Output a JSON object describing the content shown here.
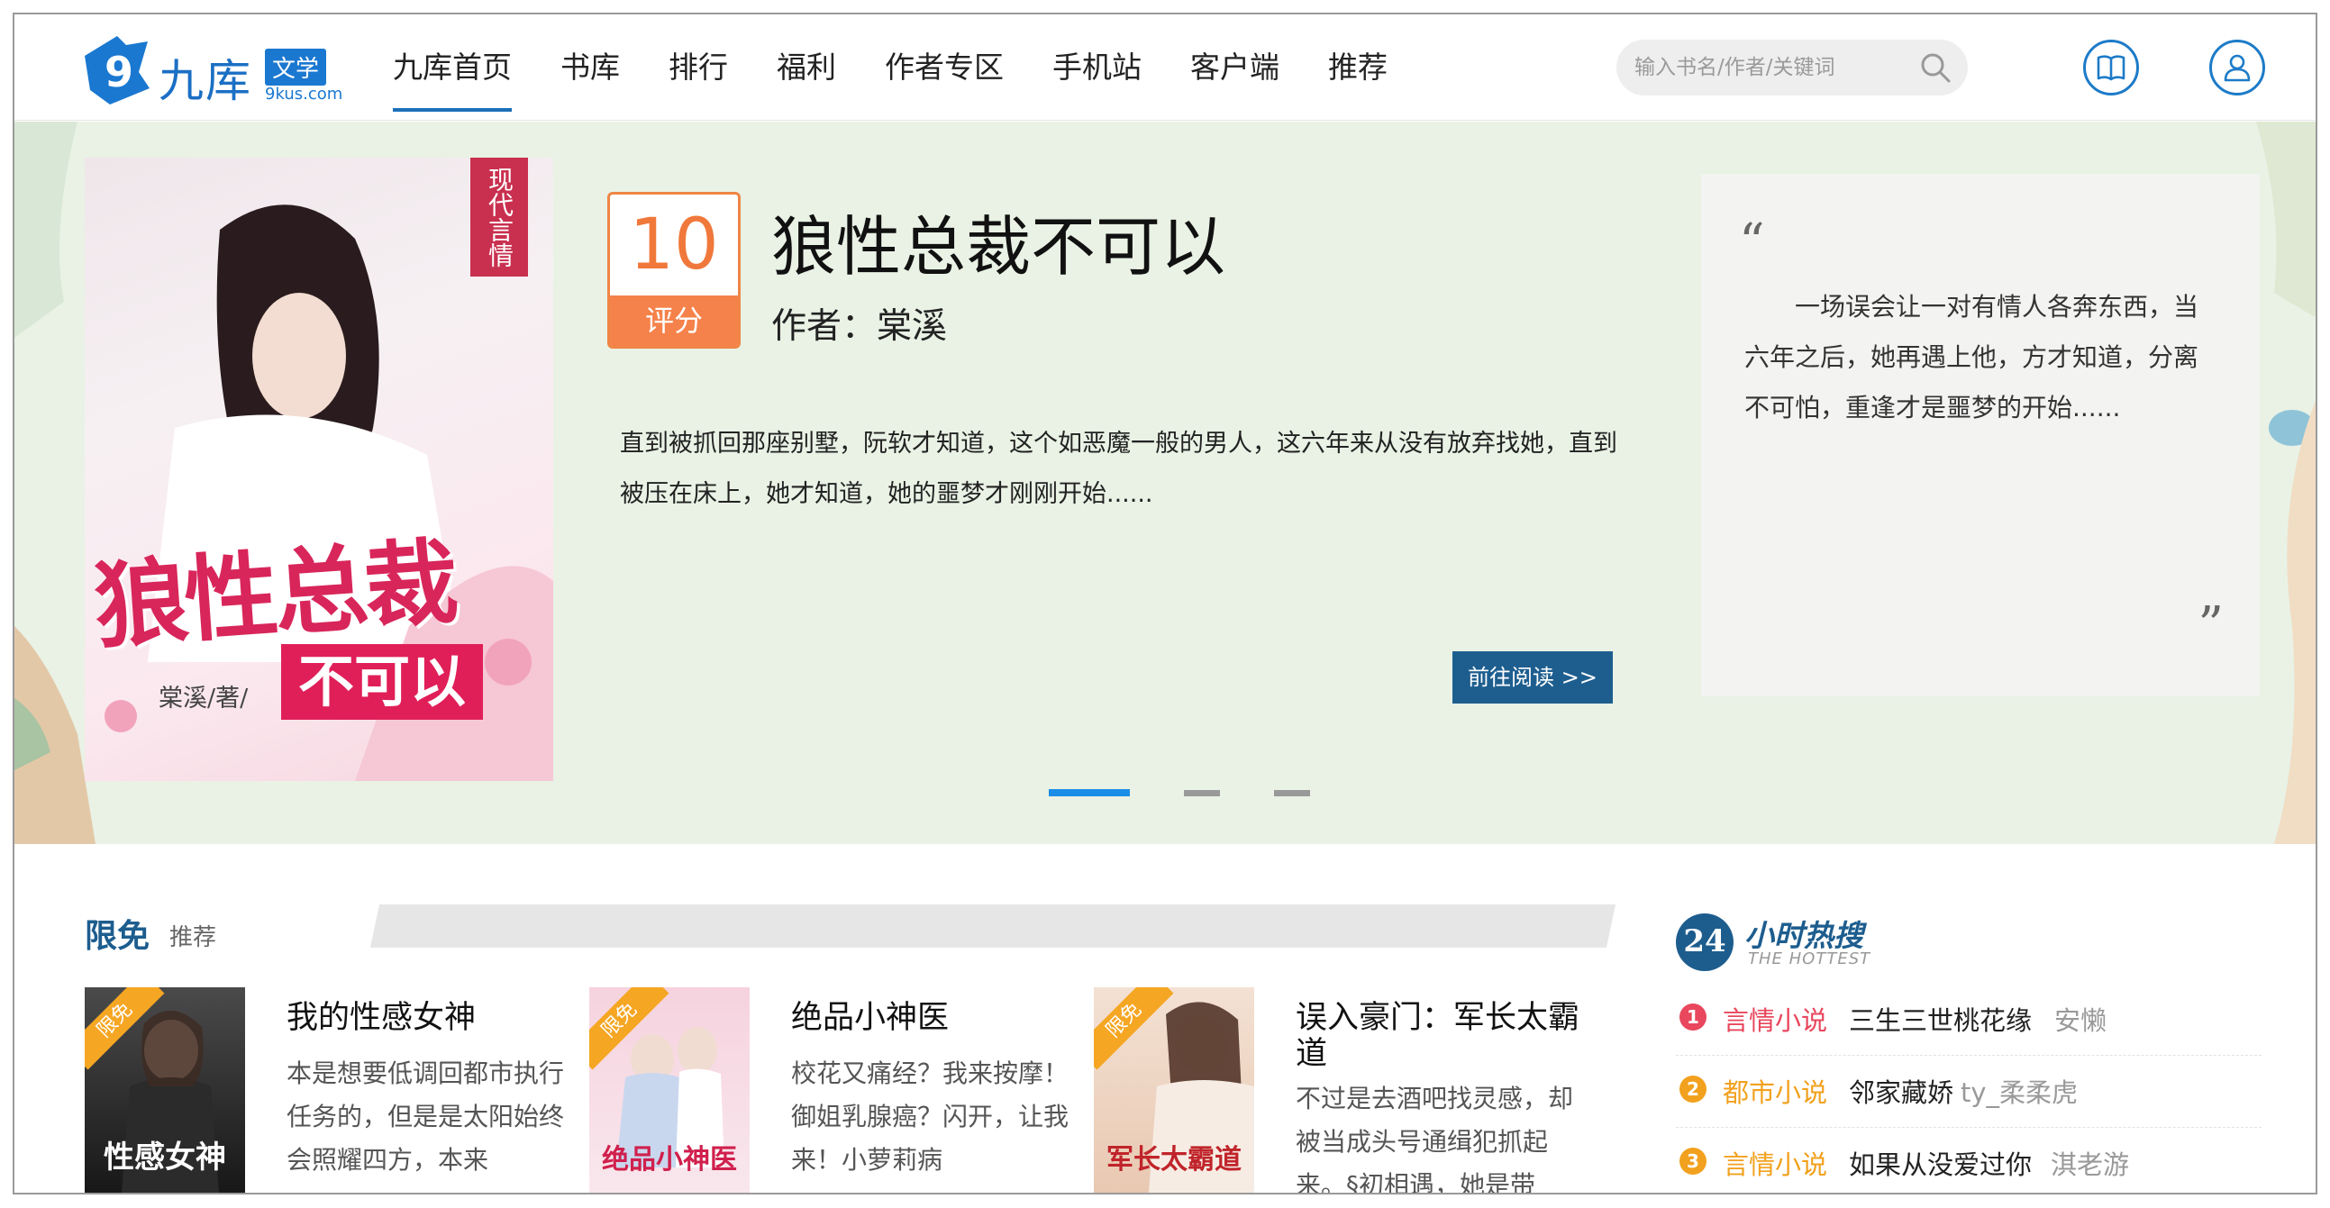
{
  "site": {
    "logo_cn": "九库",
    "logo_badge": "文学",
    "logo_url": "9kus.com"
  },
  "nav": [
    {
      "label": "九库首页",
      "active": true
    },
    {
      "label": "书库"
    },
    {
      "label": "排行"
    },
    {
      "label": "福利"
    },
    {
      "label": "作者专区"
    },
    {
      "label": "手机站"
    },
    {
      "label": "客户端"
    },
    {
      "label": "推荐"
    }
  ],
  "search": {
    "placeholder": "输入书名/作者/关键词",
    "icon": "search-icon"
  },
  "header_icons": {
    "bookshelf": "book-open-icon",
    "user": "user-icon"
  },
  "banner": {
    "cover": {
      "genre_tag": "现代言情",
      "title_main": "狼性总裁",
      "title_sub": "不可以",
      "author_line": "棠溪/著/"
    },
    "score_value": "10",
    "score_label": "评分",
    "title": "狼性总裁不可以",
    "author": "作者：棠溪",
    "description": "直到被抓回那座别墅，阮软才知道，这个如恶魔一般的男人，这六年来从没有放弃找她，直到被压在床上，她才知道，她的噩梦才刚刚开始......",
    "read_button": "前往阅读 >>",
    "quote_open": "“",
    "quote_close": "”",
    "quote": "一场误会让一对有情人各奔东西，当六年之后，她再遇上他，方才知道，分离不可怕，重逢才是噩梦的开始......",
    "slides": 3,
    "active_slide": 1
  },
  "free_section": {
    "title": "限免",
    "subtitle": "推荐",
    "items": [
      {
        "ribbon": "限免",
        "cover_title": "性感女神",
        "title": "我的性感女神",
        "description": "本是想要低调回都市执行任务的，但是是太阳始终会照耀四方，本来"
      },
      {
        "ribbon": "限免",
        "cover_title": "绝品小神医",
        "title": "绝品小神医",
        "description": "校花又痛经？我来按摩！御姐乳腺癌？闪开，让我来！小萝莉病"
      },
      {
        "ribbon": "限免",
        "cover_title": "军长太霸道",
        "title": "误入豪门：军长太霸道",
        "description": "不过是去酒吧找灵感，却被当成头号通缉犯抓起来。§初相遇，她是带"
      }
    ]
  },
  "hot": {
    "badge": "24",
    "title": "小时热搜",
    "subtitle": "THE HOTTEST",
    "rows": [
      {
        "rank": "1",
        "category": "言情小说",
        "book": "三生三世桃花缘",
        "author": "安懒",
        "color": "#e8475d"
      },
      {
        "rank": "2",
        "category": "都市小说",
        "book": "邻家藏娇",
        "author": "ty_柔柔虎",
        "color": "#f2a11e"
      },
      {
        "rank": "3",
        "category": "言情小说",
        "book": "如果从没爱过你",
        "author": "淇老游",
        "color": "#f2a11e"
      }
    ]
  }
}
